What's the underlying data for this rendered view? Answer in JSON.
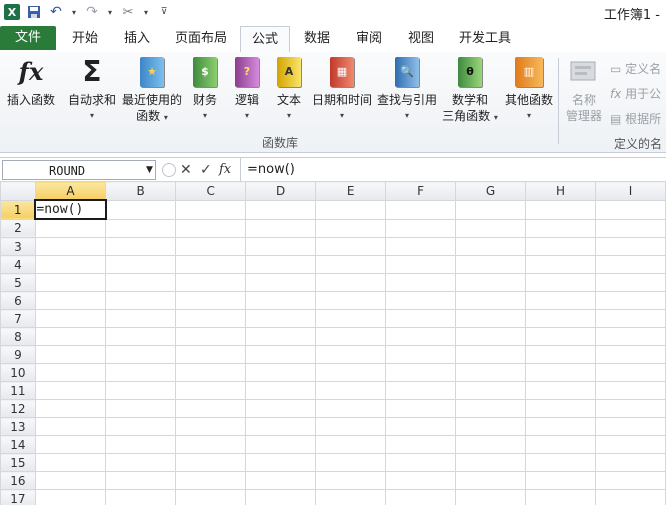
{
  "window": {
    "title": "工作簿1 -"
  },
  "quick_access": [
    {
      "name": "excel-logo-icon",
      "glyph": "X"
    },
    {
      "name": "save-icon",
      "glyph": "💾"
    },
    {
      "name": "undo-icon",
      "glyph": "↶"
    },
    {
      "name": "redo-icon",
      "glyph": "↷"
    },
    {
      "name": "customize-icon",
      "glyph": "▾"
    }
  ],
  "tabs": {
    "file": "文件",
    "home": "开始",
    "insert": "插入",
    "layout": "页面布局",
    "formulas": "公式",
    "data": "数据",
    "review": "审阅",
    "view": "视图",
    "developer": "开发工具"
  },
  "ribbon": {
    "insert_function": "插入函数",
    "autosum": "自动求和",
    "recent_line1": "最近使用的",
    "recent_line2": "函数",
    "financial": "财务",
    "logical": "逻辑",
    "text": "文本",
    "datetime": "日期和时间",
    "lookup": "查找与引用",
    "math_line1": "数学和",
    "math_line2": "三角函数",
    "more": "其他函数",
    "group_label": "函数库",
    "name_mgr_line1": "名称",
    "name_mgr_line2": "管理器",
    "define_name": "定义名",
    "use_in_formula": "用于公",
    "create_from_sel": "根据所",
    "group2_label": "定义的名"
  },
  "formula_bar": {
    "name_box": "ROUND",
    "value": "=now()",
    "fx_label": "fx"
  },
  "sheet": {
    "columns": [
      "A",
      "B",
      "C",
      "D",
      "E",
      "F",
      "G",
      "H",
      "I"
    ],
    "rows": [
      "1",
      "2",
      "3",
      "4",
      "5",
      "6",
      "7",
      "8",
      "9",
      "10",
      "11",
      "12",
      "13",
      "14",
      "15",
      "16",
      "17"
    ],
    "active_cell_text": "=now()"
  },
  "colors": {
    "file_tab": "#2a7a3a",
    "selected_header": "#f6cf63"
  }
}
